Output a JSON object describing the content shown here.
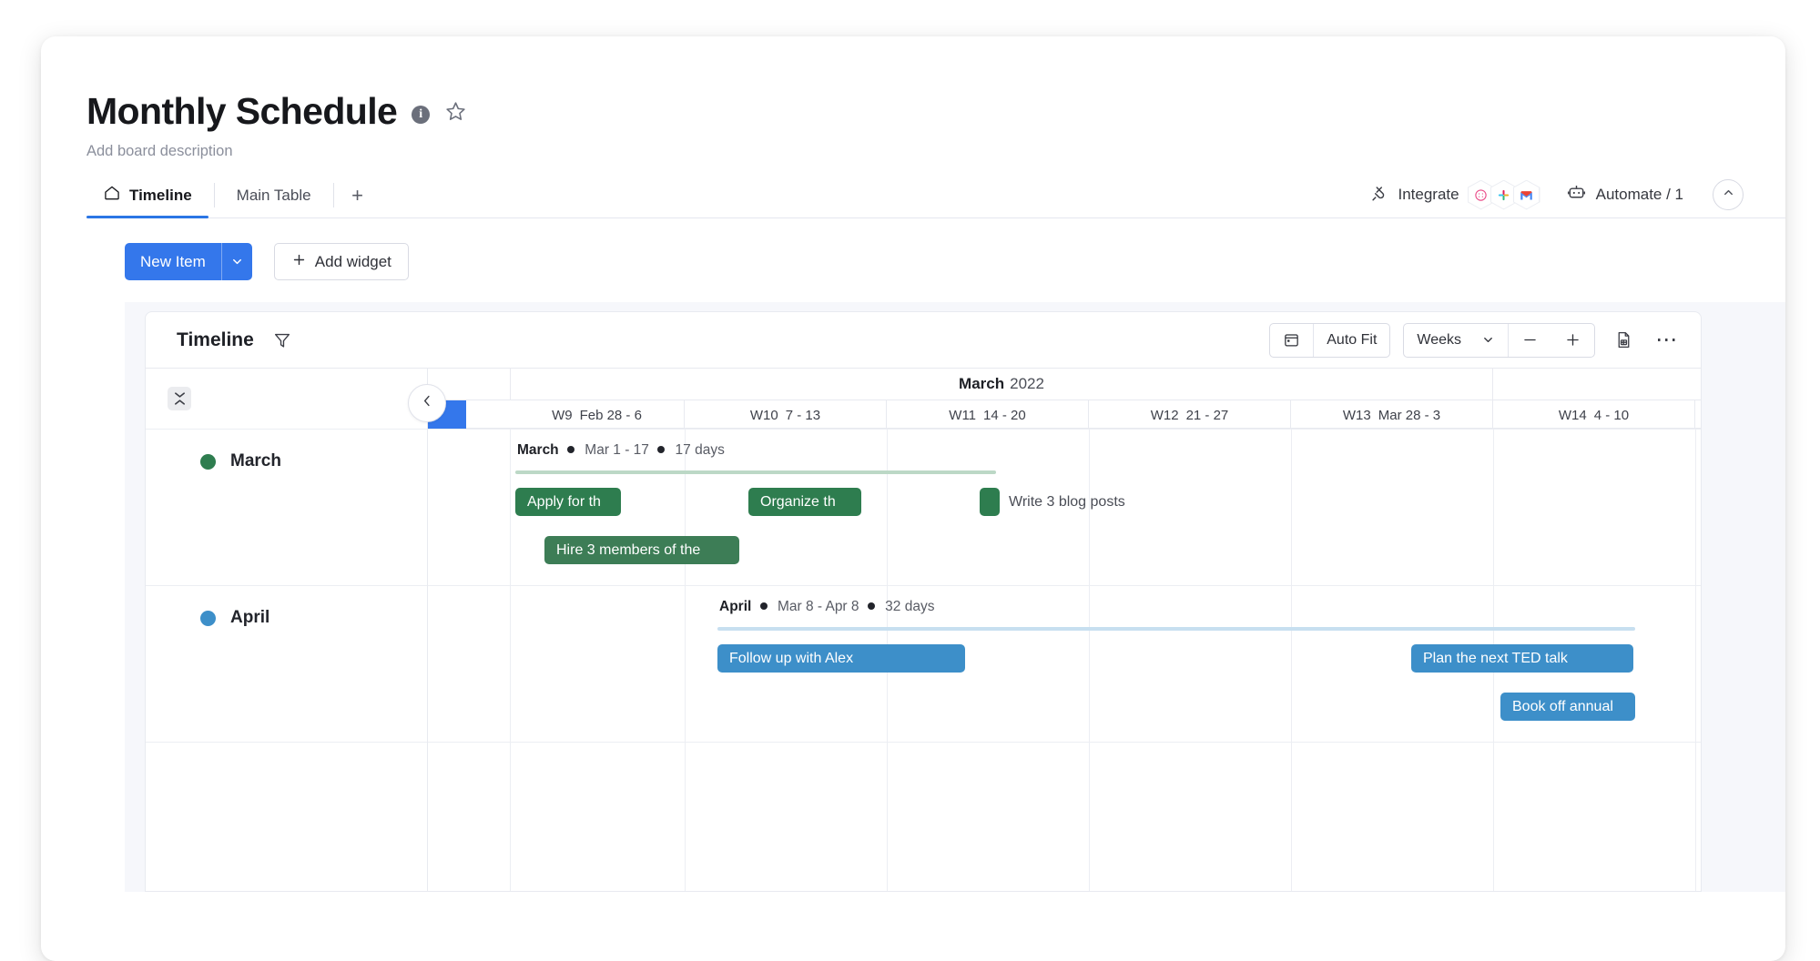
{
  "board": {
    "title": "Monthly Schedule",
    "info_icon": "info-icon",
    "star_icon": "star-icon",
    "description": "Add board description"
  },
  "tabs": [
    {
      "label": "Timeline",
      "icon": "home-icon",
      "active": true
    },
    {
      "label": "Main Table",
      "icon": "",
      "active": false
    }
  ],
  "tab_add_label": "+",
  "header_actions": {
    "integrate_label": "Integrate",
    "integrate_icon": "plug-icon",
    "integration_apps": [
      "dribbble-icon",
      "slack-icon",
      "gmail-icon"
    ],
    "automate_label": "Automate / 1",
    "automate_icon": "robot-icon",
    "collapse_icon": "chevron-up-icon"
  },
  "action_bar": {
    "new_item_label": "New Item",
    "new_item_caret_icon": "chevron-down-icon",
    "add_widget_label": "Add widget",
    "add_widget_icon": "plus-icon"
  },
  "widget": {
    "title": "Timeline",
    "filter_icon": "filter-icon",
    "calendar_icon": "calendar-icon",
    "auto_fit_label": "Auto Fit",
    "zoom_level": "Weeks",
    "zoom_caret_icon": "chevron-down-icon",
    "zoom_out_label": "—",
    "zoom_in_label": "+",
    "export_icon": "export-file-icon",
    "more_icon": "more-options-icon"
  },
  "timeline": {
    "collapse_all_icon": "collapse-all-icon",
    "prev_icon": "chevron-left-icon",
    "month_header": {
      "month": "March",
      "year": "2022"
    },
    "weeks": [
      {
        "week": "W9",
        "range": "Feb 28 - 6"
      },
      {
        "week": "W10",
        "range": "7 - 13"
      },
      {
        "week": "W11",
        "range": "14 - 20"
      },
      {
        "week": "W12",
        "range": "21 - 27"
      },
      {
        "week": "W13",
        "range": "Mar 28 - 3"
      },
      {
        "week": "W14",
        "range": "4 - 10"
      }
    ],
    "groups": [
      {
        "name": "March",
        "color": "#2e7d4f",
        "meta_title": "March",
        "meta_range": "Mar 1 - 17",
        "meta_duration": "17 days",
        "items": [
          {
            "label": "Apply for th",
            "row": 0,
            "outside": false
          },
          {
            "label": "Organize th",
            "row": 0,
            "outside": false
          },
          {
            "label": "Write 3 blog posts",
            "row": 0,
            "outside": true
          },
          {
            "label": "Hire 3 members of the",
            "row": 1,
            "outside": false
          }
        ]
      },
      {
        "name": "April",
        "color": "#3d8fc9",
        "meta_title": "April",
        "meta_range": "Mar 8 - Apr 8",
        "meta_duration": "32 days",
        "items": [
          {
            "label": "Follow up with Alex",
            "row": 0,
            "outside": false
          },
          {
            "label": "Plan the next TED talk",
            "row": 0,
            "outside": false
          },
          {
            "label": "Book off annual",
            "row": 1,
            "outside": false
          }
        ]
      }
    ]
  },
  "colors": {
    "accent_blue": "#3477eb",
    "group_green": "#2e7d4f",
    "group_blue": "#3d8fc9",
    "panel_bg": "#f6f7fb"
  }
}
